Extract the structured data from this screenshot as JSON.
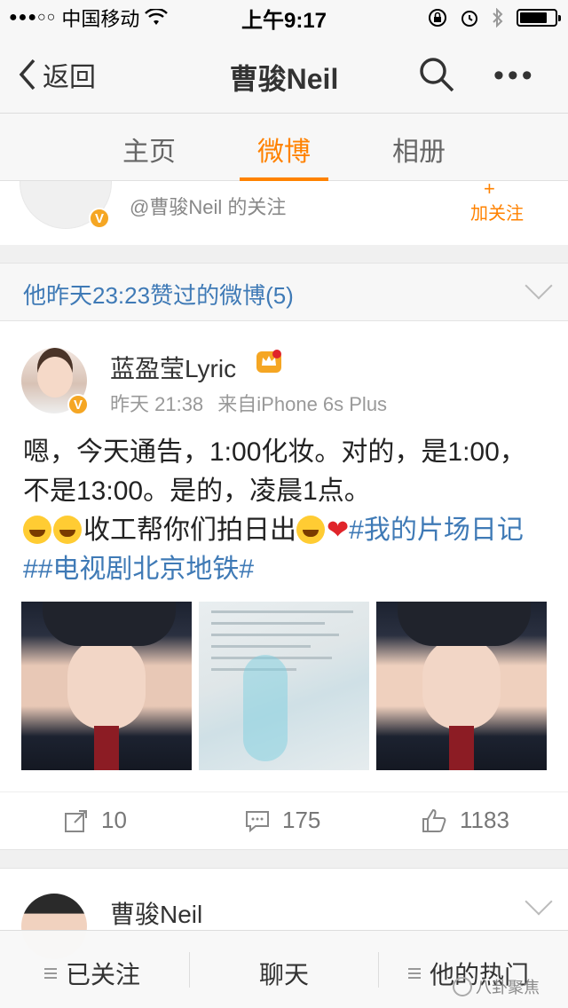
{
  "status_bar": {
    "signal": "●●●○○",
    "carrier": "中国移动",
    "time": "上午9:17"
  },
  "nav": {
    "back_label": "返回",
    "title": "曹骏Neil"
  },
  "tabs": [
    {
      "label": "主页"
    },
    {
      "label": "微博"
    },
    {
      "label": "相册"
    }
  ],
  "follow_card": {
    "text": "@曹骏Neil 的关注",
    "add_label": "加关注"
  },
  "liked_header": {
    "text": "他昨天23:23赞过的微博(5)"
  },
  "post": {
    "author": "蓝盈莹Lyric",
    "time": "昨天 21:38",
    "source": "来自iPhone 6s Plus",
    "text_1": "嗯，今天通告，1:00化妆。对的，是1:00，不是13:00。是的，凌晨1点。",
    "text_2": "收工帮你们拍日出",
    "topic_1": "#我的片场日记#",
    "topic_2": "#电视剧北京地铁#",
    "reposts": "10",
    "comments": "175",
    "likes": "1183"
  },
  "next_post": {
    "author": "曹骏Neil"
  },
  "bottom_bar": {
    "followed": "已关注",
    "chat": "聊天",
    "hot": "他的热门"
  },
  "watermark": "八卦聚焦",
  "colors": {
    "accent": "#ff8200",
    "link": "#3f7ab6",
    "verified": "#f5a623"
  }
}
